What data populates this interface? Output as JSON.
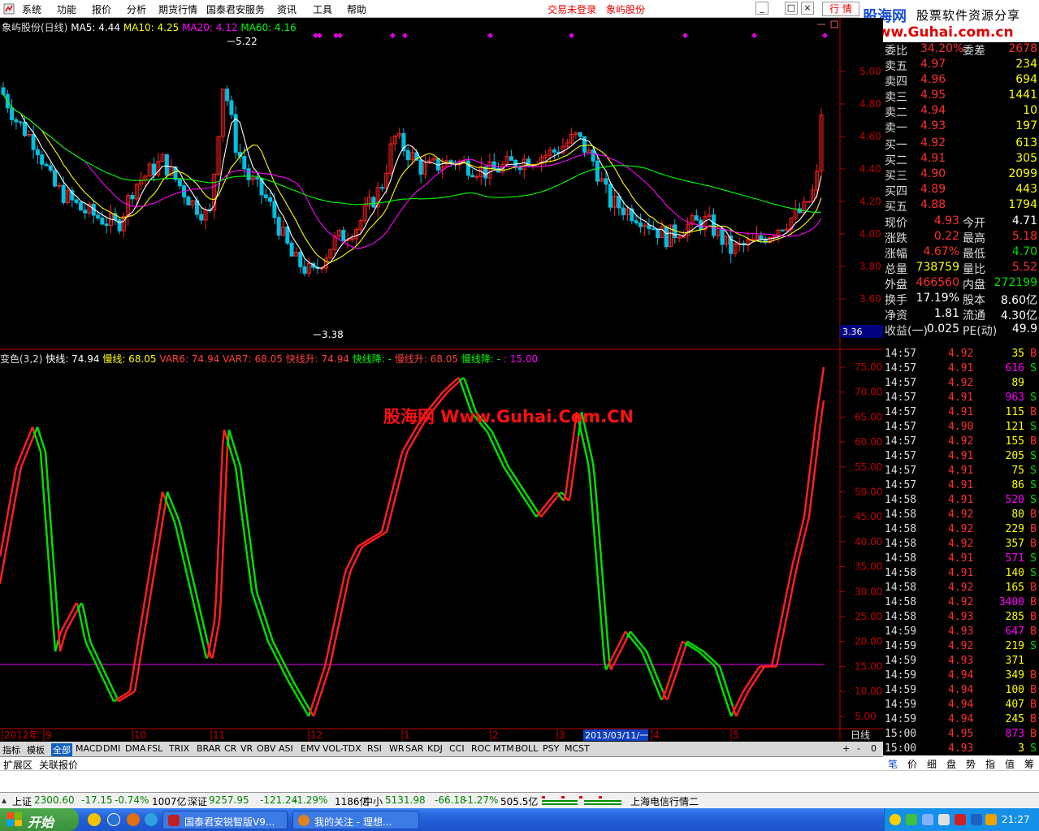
{
  "menu": {
    "items": [
      "系统",
      "功能",
      "报价",
      "分析",
      "期货行情",
      "国泰君安服务",
      "资讯",
      "工具",
      "帮助"
    ],
    "login_status": "交易未登录",
    "stock_name": "象屿股份",
    "quote_button": "行 情",
    "window_controls": [
      "_",
      "□",
      "×"
    ]
  },
  "brand": {
    "name": "股海网",
    "slogan": "股票软件资源分享",
    "url": "Www.Guhai.com.cn"
  },
  "main_chart": {
    "title": "象屿股份(日线)",
    "ma5": "MA5: 4.44",
    "ma10": "MA10: 4.25",
    "ma20": "MA20: 4.12",
    "ma60": "MA60: 4.16",
    "high_mark": "5.22",
    "low_mark": "3.38",
    "price_marker": "3.36",
    "price_ticks": [
      "5.00",
      "4.80",
      "4.60",
      "4.40",
      "4.20",
      "4.00",
      "3.80",
      "3.60"
    ]
  },
  "indicator": {
    "name": "变色(3,2)",
    "kx": "快线: 74.94",
    "mx": "慢线: 68.05",
    "var6": "VAR6: 74.94",
    "var7": "VAR7: 68.05",
    "kxs": "快线升: 74.94",
    "kxj": "快线降: -",
    "mxs": "慢线升: 68.05",
    "mxj": "慢线降: -",
    "level": ": 15.00",
    "watermark": "股海网 Www.Guhai.Com.CN",
    "ticks": [
      "75.00",
      "70.00",
      "65.00",
      "60.00",
      "55.00",
      "50.00",
      "45.00",
      "40.00",
      "35.00",
      "30.00",
      "25.00",
      "20.00",
      "15.00",
      "10.00",
      "5.00"
    ]
  },
  "time_axis": {
    "labels": [
      "2012年",
      "9",
      "10",
      "11",
      "12",
      "1",
      "2",
      "3",
      "4",
      "5"
    ],
    "cursor_date": "2013/03/11/一",
    "period": "日线"
  },
  "colors": {
    "up": "#ff2020",
    "down": "#00e000",
    "ma5": "#ffffff",
    "ma10": "#ffff00",
    "ma20": "#ff00ff",
    "ma60": "#00ff00",
    "axis": "#c00000",
    "bg": "#000000"
  },
  "order_book": {
    "weibi": {
      "label": "委比",
      "value": "34.20%",
      "label2": "委差",
      "value2": "2678"
    },
    "sells": [
      {
        "label": "卖五",
        "price": "4.97",
        "vol": "234"
      },
      {
        "label": "卖四",
        "price": "4.96",
        "vol": "694"
      },
      {
        "label": "卖三",
        "price": "4.95",
        "vol": "1441"
      },
      {
        "label": "卖二",
        "price": "4.94",
        "vol": "10"
      },
      {
        "label": "卖一",
        "price": "4.93",
        "vol": "197"
      }
    ],
    "buys": [
      {
        "label": "买一",
        "price": "4.92",
        "vol": "613"
      },
      {
        "label": "买二",
        "price": "4.91",
        "vol": "305"
      },
      {
        "label": "买三",
        "price": "4.90",
        "vol": "2099"
      },
      {
        "label": "买四",
        "price": "4.89",
        "vol": "443"
      },
      {
        "label": "买五",
        "price": "4.88",
        "vol": "1794"
      }
    ]
  },
  "stats": [
    {
      "l1": "现价",
      "v1": "4.93",
      "l2": "今开",
      "v2": "4.71",
      "c1": "#ff3030",
      "c2": "#ffffff"
    },
    {
      "l1": "涨跌",
      "v1": "0.22",
      "l2": "最高",
      "v2": "5.18",
      "c1": "#ff3030",
      "c2": "#ff3030"
    },
    {
      "l1": "涨幅",
      "v1": "4.67%",
      "l2": "最低",
      "v2": "4.70",
      "c1": "#ff3030",
      "c2": "#00e000"
    },
    {
      "l1": "总量",
      "v1": "738759",
      "l2": "量比",
      "v2": "5.52",
      "c1": "#ffff00",
      "c2": "#ff3030"
    },
    {
      "l1": "外盘",
      "v1": "466560",
      "l2": "内盘",
      "v2": "272199",
      "c1": "#ff3030",
      "c2": "#00e000"
    },
    {
      "l1": "换手",
      "v1": "17.19%",
      "l2": "股本",
      "v2": "8.60亿",
      "c1": "#ffffff",
      "c2": "#ffffff"
    },
    {
      "l1": "净资",
      "v1": "1.81",
      "l2": "流通",
      "v2": "4.30亿",
      "c1": "#ffffff",
      "c2": "#ffffff"
    },
    {
      "l1": "收益(一)",
      "v1": "0.025",
      "l2": "PE(动)",
      "v2": "49.9",
      "c1": "#ffffff",
      "c2": "#ffffff"
    }
  ],
  "ticks": [
    {
      "t": "14:57",
      "p": "4.92",
      "v": "35",
      "s": "B"
    },
    {
      "t": "14:57",
      "p": "4.91",
      "v": "616",
      "s": "S"
    },
    {
      "t": "14:57",
      "p": "4.92",
      "v": "89",
      "s": ""
    },
    {
      "t": "14:57",
      "p": "4.91",
      "v": "963",
      "s": "S"
    },
    {
      "t": "14:57",
      "p": "4.91",
      "v": "115",
      "s": "B"
    },
    {
      "t": "14:57",
      "p": "4.90",
      "v": "121",
      "s": "S"
    },
    {
      "t": "14:57",
      "p": "4.92",
      "v": "155",
      "s": "B"
    },
    {
      "t": "14:57",
      "p": "4.91",
      "v": "205",
      "s": "S"
    },
    {
      "t": "14:57",
      "p": "4.91",
      "v": "75",
      "s": "S"
    },
    {
      "t": "14:57",
      "p": "4.91",
      "v": "86",
      "s": "S"
    },
    {
      "t": "14:58",
      "p": "4.91",
      "v": "520",
      "s": "S"
    },
    {
      "t": "14:58",
      "p": "4.92",
      "v": "80",
      "s": "B"
    },
    {
      "t": "14:58",
      "p": "4.92",
      "v": "229",
      "s": "B"
    },
    {
      "t": "14:58",
      "p": "4.92",
      "v": "357",
      "s": "B"
    },
    {
      "t": "14:58",
      "p": "4.91",
      "v": "571",
      "s": "S"
    },
    {
      "t": "14:58",
      "p": "4.91",
      "v": "140",
      "s": "S"
    },
    {
      "t": "14:58",
      "p": "4.92",
      "v": "165",
      "s": "B"
    },
    {
      "t": "14:58",
      "p": "4.92",
      "v": "3400",
      "s": "B"
    },
    {
      "t": "14:58",
      "p": "4.93",
      "v": "285",
      "s": "B"
    },
    {
      "t": "14:59",
      "p": "4.93",
      "v": "647",
      "s": "B"
    },
    {
      "t": "14:59",
      "p": "4.92",
      "v": "219",
      "s": "S"
    },
    {
      "t": "14:59",
      "p": "4.93",
      "v": "371",
      "s": ""
    },
    {
      "t": "14:59",
      "p": "4.94",
      "v": "349",
      "s": "B"
    },
    {
      "t": "14:59",
      "p": "4.94",
      "v": "100",
      "s": "B"
    },
    {
      "t": "14:59",
      "p": "4.94",
      "v": "407",
      "s": "B"
    },
    {
      "t": "14:59",
      "p": "4.94",
      "v": "245",
      "s": "B"
    },
    {
      "t": "15:00",
      "p": "4.95",
      "v": "873",
      "s": "B"
    },
    {
      "t": "15:00",
      "p": "4.93",
      "v": "3",
      "s": "S"
    }
  ],
  "indicator_tabs": [
    "指标",
    "模板",
    "全部",
    "MACD",
    "DMI",
    "DMA",
    "FSL",
    "TRIX",
    "BRAR",
    "CR",
    "VR",
    "OBV",
    "ASI",
    "EMV",
    "VOL-TDX",
    "RSI",
    "WR",
    "SAR",
    "KDJ",
    "CCI",
    "ROC",
    "MTM",
    "BOLL",
    "PSY",
    "MCST"
  ],
  "zoom_buttons": [
    "+",
    "-",
    "0"
  ],
  "ext_tabs": [
    "扩展区",
    "关联报价"
  ],
  "right_tabs": [
    "笔",
    "价",
    "细",
    "盘",
    "势",
    "指",
    "值",
    "筹"
  ],
  "status_bar": {
    "sh_label": "上证",
    "sh_val": "2300.60",
    "sh_chg": "-17.15",
    "sh_pct": "-0.74%",
    "sh_amt": "1007亿",
    "sz_label": "深证",
    "sz_val": "9257.95",
    "sz_chg": "-121.24",
    "sz_pct": "-1.29%",
    "sz_amt": "1186亿",
    "zx_label": "中小",
    "zx_val": "5131.98",
    "zx_chg": "-66.18",
    "zx_pct": "-1.27%",
    "zx_amt": "505.5亿",
    "server": "上海电信行情二"
  },
  "taskbar": {
    "start": "开始",
    "windows": [
      "国泰君安锐智版V9...",
      "我的关注 - 理想..."
    ],
    "clock": "21:27"
  }
}
